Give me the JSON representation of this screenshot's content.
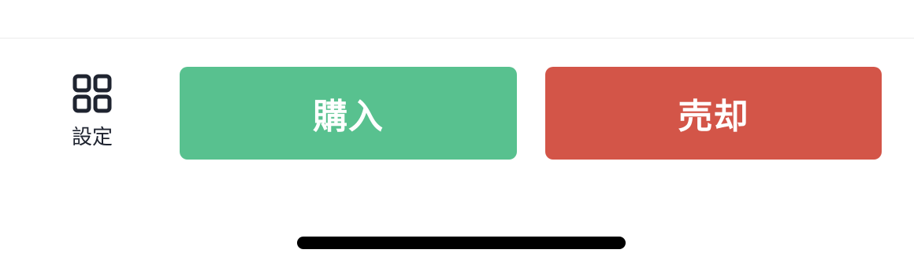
{
  "settings": {
    "label": "設定",
    "icon": "grid-icon",
    "icon_color": "#1f2430"
  },
  "actions": {
    "buy": {
      "label": "購入",
      "color": "#58c18f"
    },
    "sell": {
      "label": "売却",
      "color": "#d35548"
    }
  },
  "system": {
    "home_indicator": "home-indicator"
  }
}
